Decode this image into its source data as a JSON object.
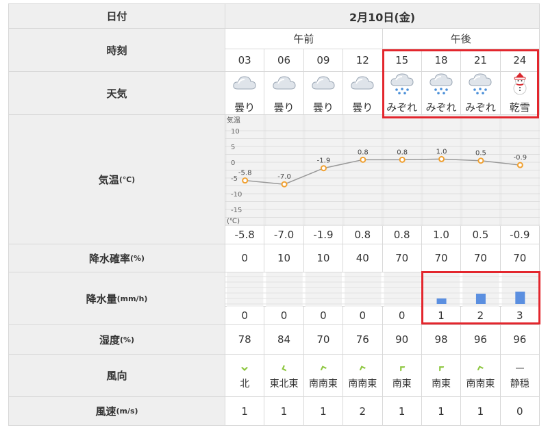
{
  "labels": {
    "date": "日付",
    "time": "時刻",
    "weather": "天気",
    "temp": "気温",
    "temp_unit": "(℃)",
    "precip_prob": "降水確率",
    "precip_prob_unit": "(%)",
    "precip_amount": "降水量",
    "precip_amount_unit": "(mm/h)",
    "humidity": "湿度",
    "humidity_unit": "(%)",
    "wind_dir": "風向",
    "wind_speed": "風速",
    "wind_speed_unit": "(m/s)"
  },
  "date": "2月10日(金)",
  "periods": {
    "am": "午前",
    "pm": "午後"
  },
  "hours": [
    "03",
    "06",
    "09",
    "12",
    "15",
    "18",
    "21",
    "24"
  ],
  "weather": [
    {
      "icon": "cloudy-icon",
      "text": "曇り"
    },
    {
      "icon": "cloudy-icon",
      "text": "曇り"
    },
    {
      "icon": "cloudy-icon",
      "text": "曇り"
    },
    {
      "icon": "cloudy-icon",
      "text": "曇り"
    },
    {
      "icon": "sleet-icon",
      "text": "みぞれ"
    },
    {
      "icon": "sleet-icon",
      "text": "みぞれ"
    },
    {
      "icon": "sleet-icon",
      "text": "みぞれ"
    },
    {
      "icon": "snowman-icon",
      "text": "乾雪"
    }
  ],
  "temps": [
    "-5.8",
    "-7.0",
    "-1.9",
    "0.8",
    "0.8",
    "1.0",
    "0.5",
    "-0.9"
  ],
  "precip_prob": [
    "0",
    "10",
    "10",
    "40",
    "70",
    "70",
    "70",
    "70"
  ],
  "precip_amount": [
    "0",
    "0",
    "0",
    "0",
    "0",
    "1",
    "2",
    "3"
  ],
  "humidity": [
    "78",
    "84",
    "70",
    "76",
    "90",
    "98",
    "96",
    "96"
  ],
  "wind_dir": [
    {
      "icon": "wind-arrow-icon",
      "text": "北"
    },
    {
      "icon": "wind-arrow-icon",
      "text": "東北東"
    },
    {
      "icon": "wind-arrow-icon",
      "text": "南南東"
    },
    {
      "icon": "wind-arrow-icon",
      "text": "南南東"
    },
    {
      "icon": "wind-arrow-icon",
      "text": "南東"
    },
    {
      "icon": "wind-arrow-icon",
      "text": "南東"
    },
    {
      "icon": "wind-arrow-icon",
      "text": "南南東"
    },
    {
      "icon": "calm-dash-icon",
      "text": "静穏"
    }
  ],
  "wind_speed": [
    "1",
    "1",
    "1",
    "2",
    "1",
    "1",
    "1",
    "0"
  ],
  "chart_data": {
    "type": "line",
    "ylabel": "気温",
    "yunit": "(℃)",
    "ylim": [
      -20,
      10
    ],
    "yticks": [
      "10",
      "5",
      "0",
      "-5",
      "-10",
      "-15"
    ],
    "x": [
      "03",
      "06",
      "09",
      "12",
      "15",
      "18",
      "21",
      "24"
    ],
    "values": [
      -5.8,
      -7.0,
      -1.9,
      0.8,
      0.8,
      1.0,
      0.5,
      -0.9
    ],
    "point_labels": [
      "-5.8",
      "-7.0",
      "-1.9",
      "0.8",
      "0.8",
      "1.0",
      "0.5",
      "-0.9"
    ],
    "precip_bars": [
      0,
      0,
      0,
      0,
      0,
      1,
      2,
      3
    ],
    "colors": {
      "line": "#999999",
      "point": "#f0a030",
      "bar": "#5b8fe0",
      "highlight": "#e3262d"
    }
  }
}
